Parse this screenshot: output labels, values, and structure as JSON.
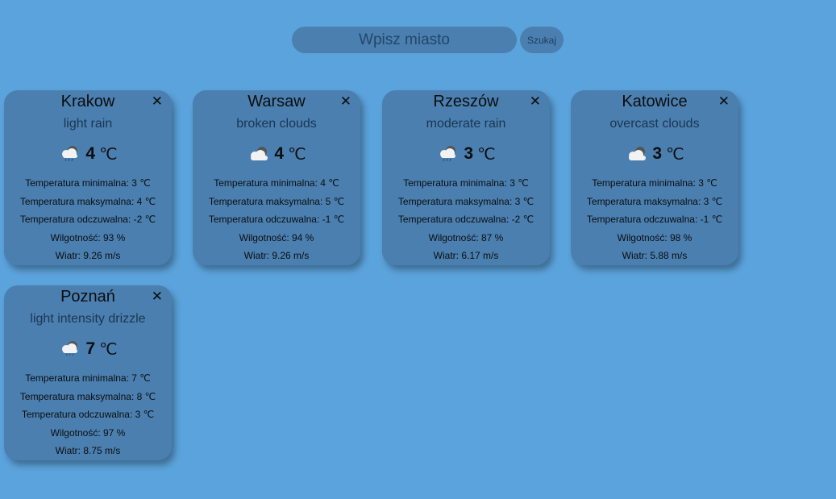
{
  "search": {
    "placeholder": "Wpisz miasto",
    "button_label": "Szukaj"
  },
  "colors": {
    "background": "#5ba3dc",
    "card": "#4a7fb0"
  },
  "cards": [
    {
      "city": "Krakow",
      "close": "✕",
      "description": "light rain",
      "icon": "rain-cloud-icon",
      "temp": "4",
      "unit": "℃",
      "min": "Temperatura minimalna: 3 ℃",
      "max": "Temperatura maksymalna: 4 ℃",
      "feels": "Temperatura odczuwalna: -2 ℃",
      "humidity": "Wilgotność: 93 %",
      "wind": "Wiatr: 9.26 m/s"
    },
    {
      "city": "Warsaw",
      "close": "✕",
      "description": "broken clouds",
      "icon": "clouds-icon",
      "temp": "4",
      "unit": "℃",
      "min": "Temperatura minimalna: 4 ℃",
      "max": "Temperatura maksymalna: 5 ℃",
      "feels": "Temperatura odczuwalna: -1 ℃",
      "humidity": "Wilgotność: 94 %",
      "wind": "Wiatr: 9.26 m/s"
    },
    {
      "city": "Rzeszów",
      "close": "✕",
      "description": "moderate rain",
      "icon": "rain-cloud-icon",
      "temp": "3",
      "unit": "℃",
      "min": "Temperatura minimalna: 3 ℃",
      "max": "Temperatura maksymalna: 3 ℃",
      "feels": "Temperatura odczuwalna: -2 ℃",
      "humidity": "Wilgotność: 87 %",
      "wind": "Wiatr: 6.17 m/s"
    },
    {
      "city": "Katowice",
      "close": "✕",
      "description": "overcast clouds",
      "icon": "clouds-icon",
      "temp": "3",
      "unit": "℃",
      "min": "Temperatura minimalna: 3 ℃",
      "max": "Temperatura maksymalna: 3 ℃",
      "feels": "Temperatura odczuwalna: -1 ℃",
      "humidity": "Wilgotność: 98 %",
      "wind": "Wiatr: 5.88 m/s"
    },
    {
      "city": "Poznań",
      "close": "✕",
      "description": "light intensity drizzle",
      "icon": "drizzle-cloud-icon",
      "temp": "7",
      "unit": "℃",
      "min": "Temperatura minimalna: 7 ℃",
      "max": "Temperatura maksymalna: 8 ℃",
      "feels": "Temperatura odczuwalna: 3 ℃",
      "humidity": "Wilgotność: 97 %",
      "wind": "Wiatr: 8.75 m/s"
    }
  ]
}
